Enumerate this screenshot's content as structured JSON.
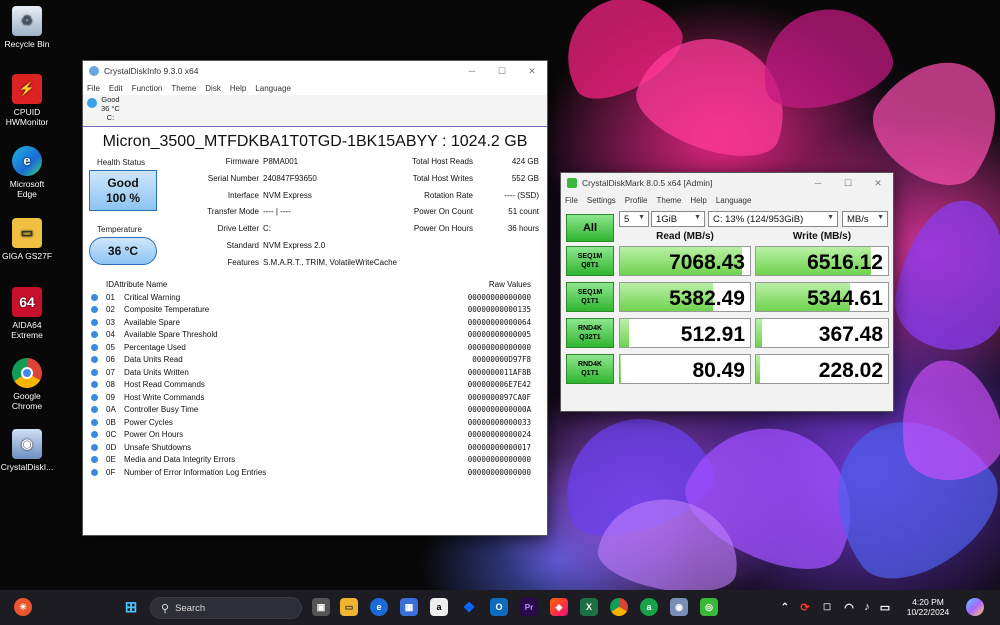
{
  "desktop": {
    "icons": [
      {
        "label": "Recycle Bin"
      },
      {
        "label": "CPUID HWMonitor"
      },
      {
        "label": "Microsoft Edge"
      },
      {
        "label": "GIGA GS27F"
      },
      {
        "label": "AIDA64 Extreme"
      },
      {
        "label": "Google Chrome"
      },
      {
        "label": "CrystalDiskI..."
      }
    ]
  },
  "cdi": {
    "title": "CrystalDiskInfo 9.3.0 x64",
    "menu": [
      "File",
      "Edit",
      "Function",
      "Theme",
      "Disk",
      "Help",
      "Language"
    ],
    "drive_tab": {
      "status": "Good",
      "temp": "36 °C",
      "letter": "C:"
    },
    "model": "Micron_3500_MTFDKBA1T0TGD-1BK15ABYY : 1024.2 GB",
    "health_label": "Health Status",
    "health_status": "Good",
    "health_percent": "100 %",
    "temperature_label": "Temperature",
    "temperature_value": "36 °C",
    "left_info": [
      {
        "key": "Firmware",
        "value": "P8MA001"
      },
      {
        "key": "Serial Number",
        "value": "240847F93650"
      },
      {
        "key": "Interface",
        "value": "NVM Express"
      },
      {
        "key": "Transfer Mode",
        "value": "---- | ----"
      },
      {
        "key": "Drive Letter",
        "value": "C:"
      },
      {
        "key": "Standard",
        "value": "NVM Express 2.0"
      },
      {
        "key": "Features",
        "value": "S.M.A.R.T., TRIM, VolatileWriteCache"
      }
    ],
    "right_info": [
      {
        "key": "Total Host Reads",
        "value": "424 GB"
      },
      {
        "key": "Total Host Writes",
        "value": "552 GB"
      },
      {
        "key": "Rotation Rate",
        "value": "---- (SSD)"
      },
      {
        "key": "Power On Count",
        "value": "51 count"
      },
      {
        "key": "Power On Hours",
        "value": "36 hours"
      }
    ],
    "table_headers": {
      "id": "ID",
      "name": "Attribute Name",
      "raw": "Raw Values"
    },
    "attributes": [
      {
        "id": "01",
        "name": "Critical Warning",
        "raw": "00000000000000"
      },
      {
        "id": "02",
        "name": "Composite Temperature",
        "raw": "00000000000135"
      },
      {
        "id": "03",
        "name": "Available Spare",
        "raw": "00000000000064"
      },
      {
        "id": "04",
        "name": "Available Spare Threshold",
        "raw": "00000000000005"
      },
      {
        "id": "05",
        "name": "Percentage Used",
        "raw": "00000000000000"
      },
      {
        "id": "06",
        "name": "Data Units Read",
        "raw": "00000000D97F8"
      },
      {
        "id": "07",
        "name": "Data Units Written",
        "raw": "0000000011AF8B"
      },
      {
        "id": "08",
        "name": "Host Read Commands",
        "raw": "000000006E7E42"
      },
      {
        "id": "09",
        "name": "Host Write Commands",
        "raw": "0000000097CA0F"
      },
      {
        "id": "0A",
        "name": "Controller Busy Time",
        "raw": "0000000000000A"
      },
      {
        "id": "0B",
        "name": "Power Cycles",
        "raw": "00000000000033"
      },
      {
        "id": "0C",
        "name": "Power On Hours",
        "raw": "00000000000024"
      },
      {
        "id": "0D",
        "name": "Unsafe Shutdowns",
        "raw": "00000000000017"
      },
      {
        "id": "0E",
        "name": "Media and Data Integrity Errors",
        "raw": "00000000000000"
      },
      {
        "id": "0F",
        "name": "Number of Error Information Log Entries",
        "raw": "00000000000000"
      }
    ]
  },
  "cdm": {
    "title": "CrystalDiskMark 8.0.5 x64 [Admin]",
    "menu": [
      "File",
      "Settings",
      "Profile",
      "Theme",
      "Help",
      "Language"
    ],
    "all_label": "All",
    "count": "5",
    "size": "1GiB",
    "drive": "C: 13% (124/953GiB)",
    "unit": "MB/s",
    "read_header": "Read (MB/s)",
    "write_header": "Write (MB/s)",
    "max_scale": 7500,
    "tests": [
      {
        "line1": "SEQ1M",
        "line2": "Q8T1",
        "read": "7068.43",
        "write": "6516.12"
      },
      {
        "line1": "SEQ1M",
        "line2": "Q1T1",
        "read": "5382.49",
        "write": "5344.61"
      },
      {
        "line1": "RND4K",
        "line2": "Q32T1",
        "read": "512.91",
        "write": "367.48"
      },
      {
        "line1": "RND4K",
        "line2": "Q1T1",
        "read": "80.49",
        "write": "228.02"
      }
    ]
  },
  "taskbar": {
    "search_placeholder": "Search",
    "time": "4:20 PM",
    "date": "10/22/2024"
  }
}
